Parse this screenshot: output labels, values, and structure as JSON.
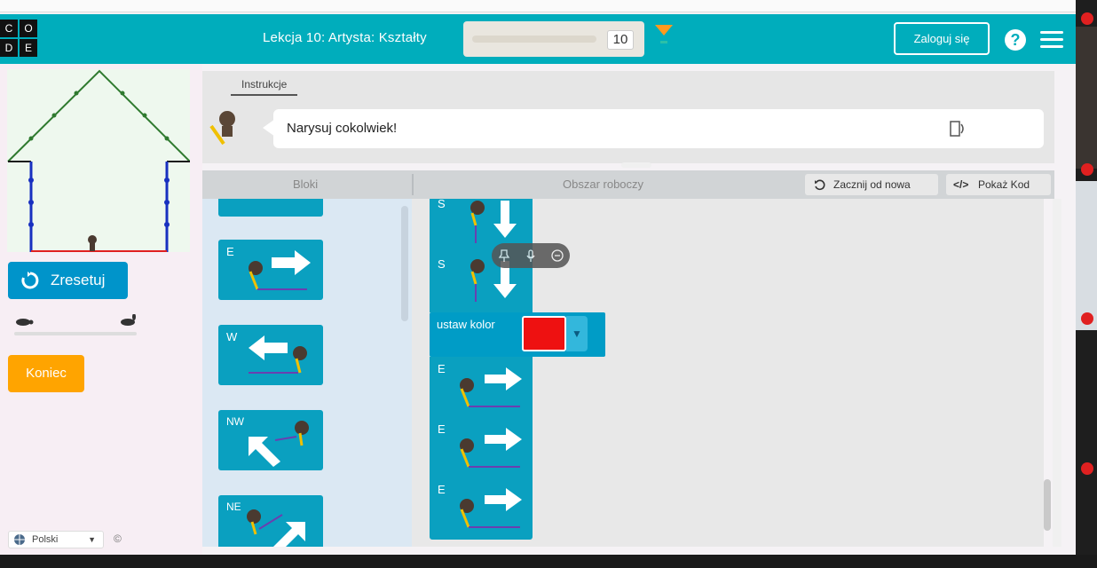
{
  "header": {
    "logo_letters": [
      "C",
      "O",
      "D",
      "E"
    ],
    "lesson_title": "Lekcja 10: Artysta: Kształty",
    "level_number": "10",
    "login_label": "Zaloguj się",
    "help_label": "?"
  },
  "left_panel": {
    "reset_label": "Zresetuj",
    "finish_label": "Koniec",
    "language": "Polski",
    "copyright": "©"
  },
  "instructions": {
    "tab_label": "Instrukcje",
    "text": "Narysuj cokolwiek!"
  },
  "workspace_header": {
    "toolbox_label": "Bloki",
    "workspace_label": "Obszar roboczy",
    "restart_label": "Zacznij od nowa",
    "show_code_label": "Pokaż Kod"
  },
  "toolbox_blocks": [
    {
      "dir": "E",
      "icon": "arrow-right-icon"
    },
    {
      "dir": "W",
      "icon": "arrow-left-icon"
    },
    {
      "dir": "NW",
      "icon": "arrow-up-left-icon"
    },
    {
      "dir": "NE",
      "icon": "arrow-up-right-icon"
    }
  ],
  "workspace_blocks": [
    {
      "dir": "S",
      "icon": "arrow-down-icon"
    },
    {
      "dir": "S",
      "icon": "arrow-down-icon"
    },
    {
      "type": "set_color",
      "label": "ustaw kolor",
      "color": "#ee1111"
    },
    {
      "dir": "E",
      "icon": "arrow-right-icon"
    },
    {
      "dir": "E",
      "icon": "arrow-right-icon"
    },
    {
      "dir": "E",
      "icon": "arrow-right-icon"
    }
  ],
  "colors": {
    "header": "#00adbc",
    "block": "#0aa0c0",
    "reset": "#0094ca",
    "finish": "#ffa400",
    "set_color_swatch": "#ee1111"
  }
}
